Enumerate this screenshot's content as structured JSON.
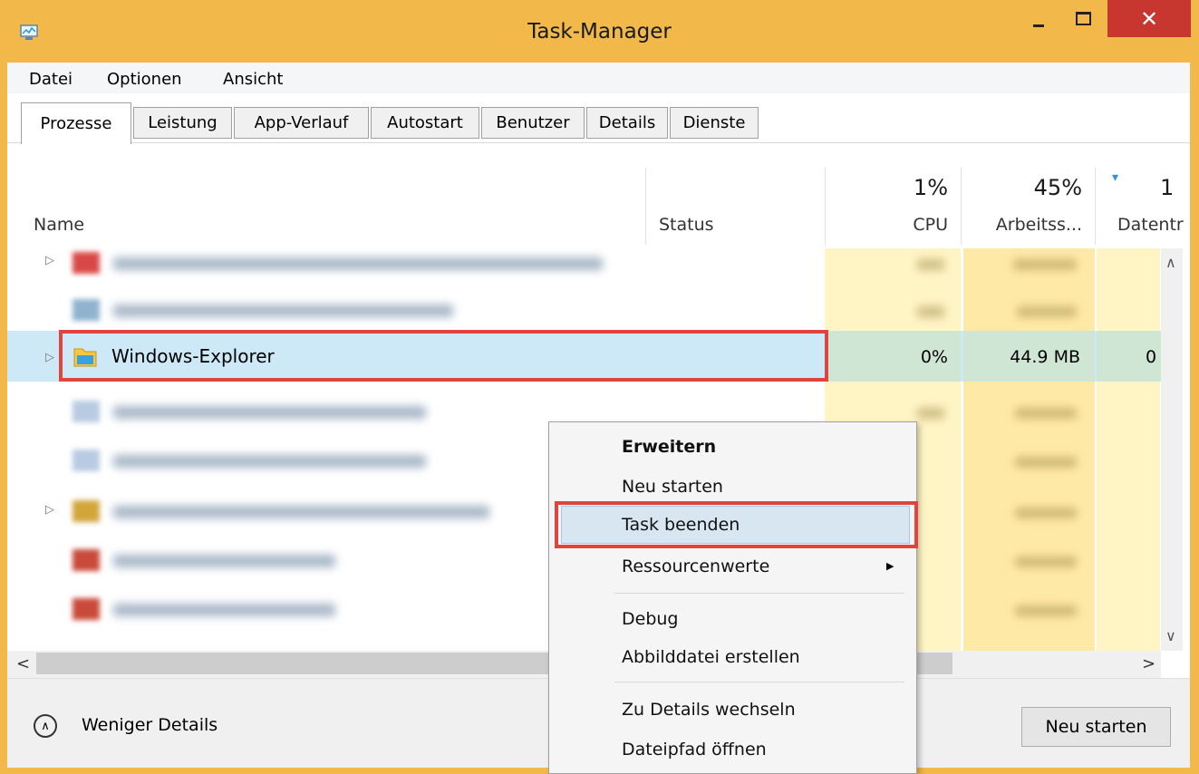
{
  "window": {
    "title": "Task-Manager",
    "close_glyph": "✕"
  },
  "menu": [
    "Datei",
    "Optionen",
    "Ansicht"
  ],
  "tabs": [
    "Prozesse",
    "Leistung",
    "App-Verlauf",
    "Autostart",
    "Benutzer",
    "Details",
    "Dienste"
  ],
  "columns": {
    "name": "Name",
    "status": "Status",
    "cpu": {
      "label": "CPU",
      "pct": "1%"
    },
    "memory": {
      "label": "Arbeitss...",
      "pct": "45%"
    },
    "disk": {
      "label": "Datentr",
      "pct": "1"
    }
  },
  "selected_process": {
    "name": "Windows-Explorer",
    "cpu": "0%",
    "memory": "44.9 MB",
    "disk": "0"
  },
  "context_menu": {
    "items": [
      "Erweitern",
      "Neu starten",
      "Task beenden",
      "Ressourcenwerte",
      "Debug",
      "Abbilddatei erstellen",
      "Zu Details wechseln",
      "Dateipfad öffnen"
    ],
    "submenu_arrow": "▶"
  },
  "footer": {
    "fewer_details": "Weniger Details",
    "restart_button": "Neu starten"
  },
  "icons": {
    "expand": "▷",
    "scroll_up": "∧",
    "scroll_down": "∨",
    "scroll_left": "<",
    "scroll_right": ">",
    "collapse_up": "∧",
    "sort": "▾"
  },
  "colors": {
    "titlebar": "#f2b84a",
    "close": "#c7372f",
    "selection": "#cde8f7",
    "highlight_box": "#e0443e"
  }
}
